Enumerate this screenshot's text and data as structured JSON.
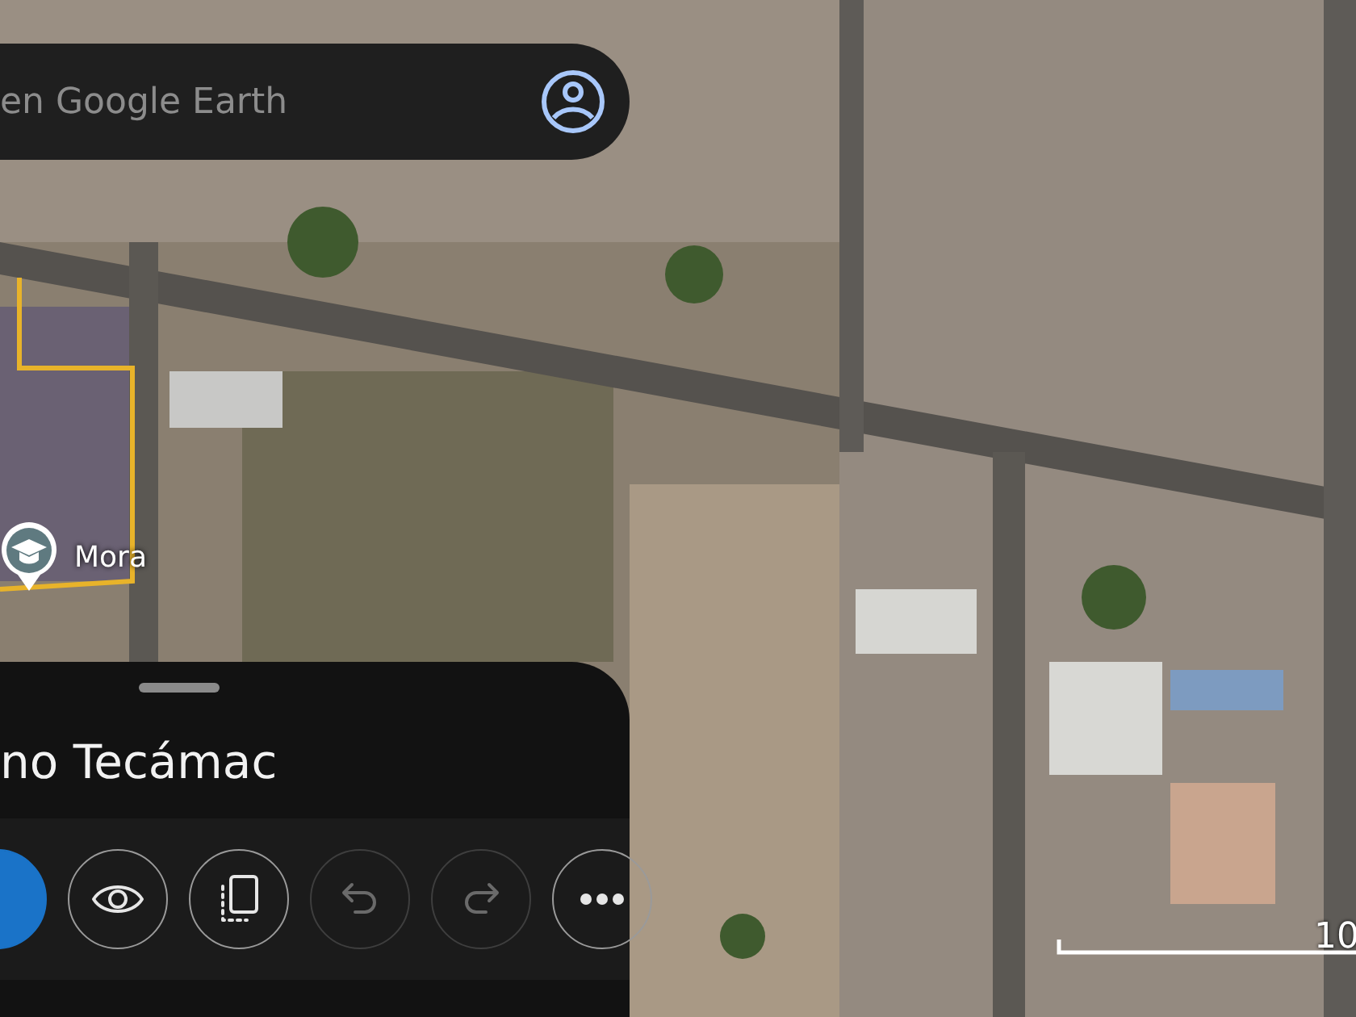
{
  "search_bar": {
    "placeholder": "en Google Earth"
  },
  "map": {
    "place_label": {
      "name": "Mora"
    },
    "scale": {
      "label": "10"
    }
  },
  "bottom_sheet": {
    "title": "no Tecámac",
    "actions": [
      {
        "kind": "primary",
        "disabled": false
      },
      {
        "kind": "eye",
        "disabled": false
      },
      {
        "kind": "pages",
        "disabled": false
      },
      {
        "kind": "undo",
        "disabled": true
      },
      {
        "kind": "redo",
        "disabled": true
      },
      {
        "kind": "more",
        "disabled": false
      }
    ]
  }
}
